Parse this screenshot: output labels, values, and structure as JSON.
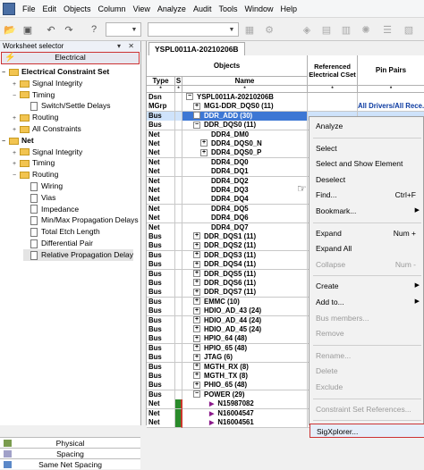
{
  "menubar": {
    "items": [
      "File",
      "Edit",
      "Objects",
      "Column",
      "View",
      "Analyze",
      "Audit",
      "Tools",
      "Window",
      "Help"
    ]
  },
  "left_panel": {
    "title": "Worksheet selector",
    "active_tab": "Electrical",
    "tree": [
      {
        "label": "Electrical Constraint Set",
        "bold": true
      },
      {
        "label": "Signal Integrity"
      },
      {
        "label": "Timing"
      },
      {
        "label": "Switch/Settle Delays"
      },
      {
        "label": "Routing"
      },
      {
        "label": "All Constraints"
      },
      {
        "label": "Net",
        "bold": true
      },
      {
        "label": "Signal Integrity"
      },
      {
        "label": "Timing"
      },
      {
        "label": "Routing"
      },
      {
        "label": "Wiring"
      },
      {
        "label": "Vias"
      },
      {
        "label": "Impedance"
      },
      {
        "label": "Min/Max Propagation Delays"
      },
      {
        "label": "Total Etch Length"
      },
      {
        "label": "Differential Pair"
      },
      {
        "label": "Relative Propagation Delay"
      }
    ],
    "bottom_tabs": [
      "Physical",
      "Spacing",
      "Same Net Spacing"
    ]
  },
  "grid": {
    "tab": "YSPL0011A-20210206B",
    "headers": {
      "objects": "Objects",
      "type": "Type",
      "s": "S",
      "name": "Name",
      "cset": "Referenced Electrical CSet",
      "pin_pairs": "Pin Pairs"
    },
    "rows": [
      {
        "type": "Dsn",
        "name": "YSPL0011A-20210206B",
        "pm": "−",
        "indent": 0,
        "pp": ""
      },
      {
        "type": "MGrp",
        "name": "MG1-DDR_DQS0 (11)",
        "pm": "+",
        "indent": 1,
        "pp": "All Drivers/All Rece..."
      },
      {
        "type": "Bus",
        "name": "DDR_ADD (30)",
        "pm": "+",
        "indent": 1,
        "pp": "",
        "hl": true
      },
      {
        "type": "Bus",
        "name": "DDR_DQS0 (11)",
        "pm": "−",
        "indent": 1,
        "pp": ""
      },
      {
        "type": "Net",
        "name": "DDR4_DM0",
        "pm": "",
        "indent": 2,
        "pp": ""
      },
      {
        "type": "Net",
        "name": "DDR4_DQS0_N",
        "pm": "+",
        "indent": 2,
        "pp": ""
      },
      {
        "type": "Net",
        "name": "DDR4_DQS0_P",
        "pm": "+",
        "indent": 2,
        "pp": ""
      },
      {
        "type": "Net",
        "name": "DDR4_DQ0",
        "pm": "",
        "indent": 2,
        "pp": ""
      },
      {
        "type": "Net",
        "name": "DDR4_DQ1",
        "pm": "",
        "indent": 2,
        "pp": ""
      },
      {
        "type": "Net",
        "name": "DDR4_DQ2",
        "pm": "",
        "indent": 2,
        "pp": ""
      },
      {
        "type": "Net",
        "name": "DDR4_DQ3",
        "pm": "",
        "indent": 2,
        "pp": ""
      },
      {
        "type": "Net",
        "name": "DDR4_DQ4",
        "pm": "",
        "indent": 2,
        "pp": ""
      },
      {
        "type": "Net",
        "name": "DDR4_DQ5",
        "pm": "",
        "indent": 2,
        "pp": ""
      },
      {
        "type": "Net",
        "name": "DDR4_DQ6",
        "pm": "",
        "indent": 2,
        "pp": ""
      },
      {
        "type": "Net",
        "name": "DDR4_DQ7",
        "pm": "",
        "indent": 2,
        "pp": ""
      },
      {
        "type": "Bus",
        "name": "DDR_DQS1 (11)",
        "pm": "+",
        "indent": 1,
        "pp": ""
      },
      {
        "type": "Bus",
        "name": "DDR_DQS2 (11)",
        "pm": "+",
        "indent": 1,
        "pp": ""
      },
      {
        "type": "Bus",
        "name": "DDR_DQS3 (11)",
        "pm": "+",
        "indent": 1,
        "pp": ""
      },
      {
        "type": "Bus",
        "name": "DDR_DQS4 (11)",
        "pm": "+",
        "indent": 1,
        "pp": ""
      },
      {
        "type": "Bus",
        "name": "DDR_DQS5 (11)",
        "pm": "+",
        "indent": 1,
        "pp": ""
      },
      {
        "type": "Bus",
        "name": "DDR_DQS6 (11)",
        "pm": "+",
        "indent": 1,
        "pp": ""
      },
      {
        "type": "Bus",
        "name": "DDR_DQS7 (11)",
        "pm": "+",
        "indent": 1,
        "pp": ""
      },
      {
        "type": "Bus",
        "name": "EMMC (10)",
        "pm": "+",
        "indent": 1,
        "pp": ""
      },
      {
        "type": "Bus",
        "name": "HDIO_AD_43 (24)",
        "pm": "+",
        "indent": 1,
        "pp": ""
      },
      {
        "type": "Bus",
        "name": "HDIO_AD_44 (24)",
        "pm": "+",
        "indent": 1,
        "pp": ""
      },
      {
        "type": "Bus",
        "name": "HDIO_AD_45 (24)",
        "pm": "+",
        "indent": 1,
        "pp": ""
      },
      {
        "type": "Bus",
        "name": "HPIO_64 (48)",
        "pm": "+",
        "indent": 1,
        "pp": ""
      },
      {
        "type": "Bus",
        "name": "HPIO_65 (48)",
        "pm": "+",
        "indent": 1,
        "pp": ""
      },
      {
        "type": "Bus",
        "name": "JTAG (6)",
        "pm": "+",
        "indent": 1,
        "pp": ""
      },
      {
        "type": "Bus",
        "name": "MGTH_RX (8)",
        "pm": "+",
        "indent": 1,
        "pp": ""
      },
      {
        "type": "Bus",
        "name": "MGTH_TX (8)",
        "pm": "+",
        "indent": 1,
        "pp": ""
      },
      {
        "type": "Bus",
        "name": "PHIO_65 (48)",
        "pm": "+",
        "indent": 1,
        "pp": ""
      },
      {
        "type": "Bus",
        "name": "POWER (29)",
        "pm": "−",
        "indent": 1,
        "pp": ""
      },
      {
        "type": "Net",
        "name": "N15987082",
        "pm": "",
        "indent": 2,
        "pp": "",
        "mark": true
      },
      {
        "type": "Net",
        "name": "N16004547",
        "pm": "",
        "indent": 2,
        "pp": "",
        "mark": true
      },
      {
        "type": "Net",
        "name": "N16004561",
        "pm": "",
        "indent": 2,
        "pp": "",
        "mark": true
      }
    ]
  },
  "context_menu": {
    "items": [
      {
        "label": "Analyze",
        "kind": "item"
      },
      {
        "kind": "sep"
      },
      {
        "label": "Select",
        "kind": "item"
      },
      {
        "label": "Select and Show Element",
        "kind": "item"
      },
      {
        "label": "Deselect",
        "kind": "item"
      },
      {
        "label": "Find...",
        "kind": "item",
        "shortcut": "Ctrl+F"
      },
      {
        "label": "Bookmark...",
        "kind": "item",
        "submenu": true
      },
      {
        "kind": "sep"
      },
      {
        "label": "Expand",
        "kind": "item",
        "shortcut": "Num +"
      },
      {
        "label": "Expand All",
        "kind": "item"
      },
      {
        "label": "Collapse",
        "kind": "item",
        "shortcut": "Num -",
        "disabled": true
      },
      {
        "kind": "sep"
      },
      {
        "label": "Create",
        "kind": "item",
        "submenu": true
      },
      {
        "label": "Add to...",
        "kind": "item",
        "submenu": true
      },
      {
        "label": "Bus members...",
        "kind": "item",
        "disabled": true
      },
      {
        "label": "Remove",
        "kind": "item",
        "disabled": true
      },
      {
        "kind": "sep"
      },
      {
        "label": "Rename...",
        "kind": "item",
        "disabled": true
      },
      {
        "label": "Delete",
        "kind": "item",
        "disabled": true
      },
      {
        "label": "Exclude",
        "kind": "item",
        "disabled": true
      },
      {
        "kind": "sep"
      },
      {
        "label": "Constraint Set References...",
        "kind": "item",
        "disabled": true
      },
      {
        "kind": "sep"
      },
      {
        "label": "SigXplorer...",
        "kind": "item",
        "hot": true
      }
    ]
  },
  "colors": {
    "highlight_row": "#3d77d4",
    "pin_pair_text": "#0b3aa1",
    "red_outline": "#cc3333",
    "folder": "#f2c450"
  }
}
